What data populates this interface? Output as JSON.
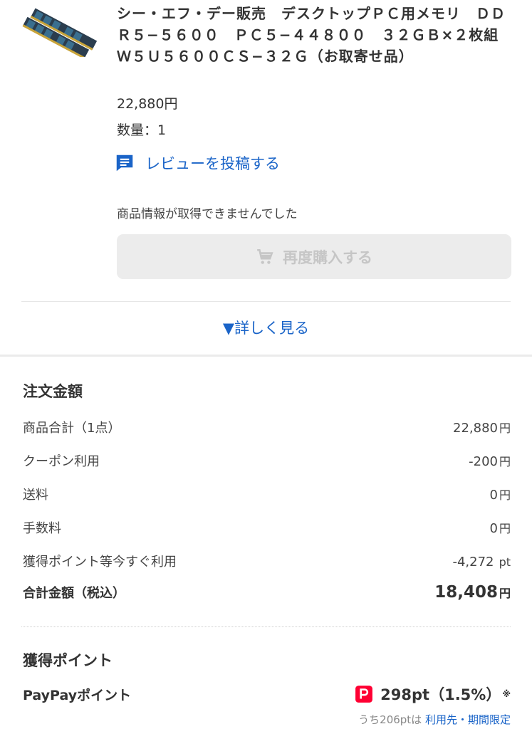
{
  "product": {
    "title": "シー・エフ・デー販売　デスクトップＰＣ用メモリ　ＤＤＲ５−５６００　ＰＣ５−４４８００　３２ＧＢ×２枚組　Ｗ５Ｕ５６００ＣＳ−３２Ｇ（お取寄せ品）",
    "price": "22,880円",
    "quantity": "数量：1",
    "review_label": "レビューを投稿する",
    "notice": "商品情報が取得できませんでした",
    "rebuy_label": "再度購入する",
    "more_label": "▼詳しく見る"
  },
  "order": {
    "title": "注文金額",
    "rows": [
      {
        "label": "商品合計（1点）",
        "value": "22,880",
        "unit": "円"
      },
      {
        "label": "クーポン利用",
        "value": "-200",
        "unit": "円"
      },
      {
        "label": "送料",
        "value": "0",
        "unit": "円"
      },
      {
        "label": "手数料",
        "value": "0",
        "unit": "円"
      },
      {
        "label": "獲得ポイント等今すぐ利用",
        "value": "-4,272",
        "unit": " pt"
      }
    ],
    "total": {
      "label": "合計金額（税込）",
      "value": "18,408",
      "unit": "円"
    }
  },
  "points": {
    "title": "獲得ポイント",
    "label": "PayPayポイント",
    "value": "298pt（1.5%）",
    "mark": "※",
    "note_prefix": "うち206ptは",
    "note_link": "利用先・期間限定"
  },
  "icons": {
    "review": "comment-icon",
    "cart": "cart-icon",
    "paypay": "paypay-icon"
  },
  "colors": {
    "link": "#1a64c8",
    "paypay_red": "#ff0033",
    "disabled_bg": "#ececec"
  }
}
